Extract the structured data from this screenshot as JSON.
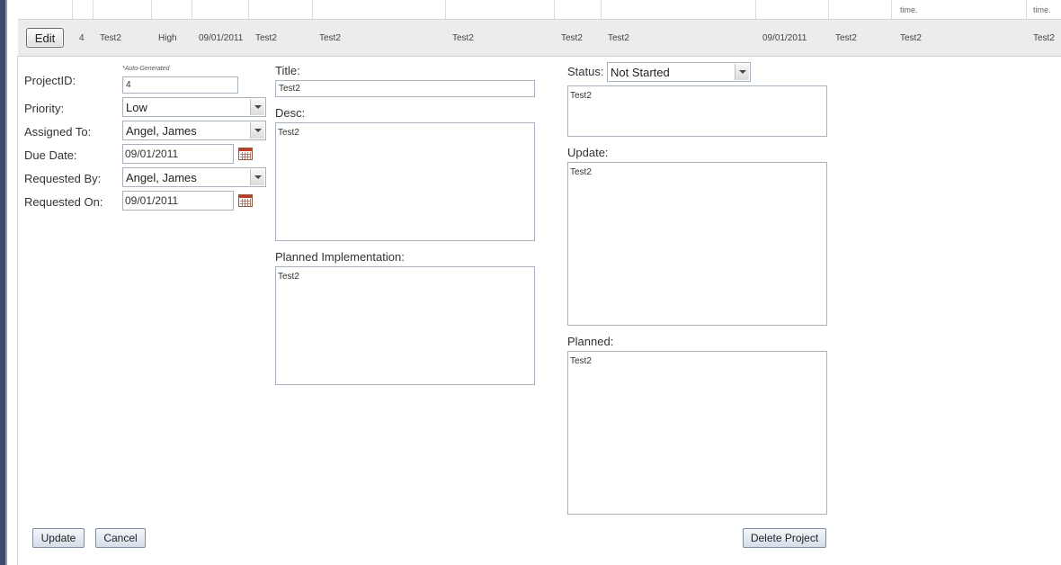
{
  "grid": {
    "header_row": {
      "time_labels": [
        "time.",
        "time."
      ]
    },
    "row": {
      "edit_label": "Edit",
      "id": "4",
      "title": "Test2",
      "priority": "High",
      "due_date": "09/01/2011",
      "col5": "Test2",
      "col6": "Test2",
      "col7": "Test2",
      "col8": "Test2",
      "col9": "Test2",
      "requested_on": "09/01/2011",
      "col11": "Test2",
      "col12": "Test2",
      "col13": "Test2"
    }
  },
  "form": {
    "project_id": {
      "label": "ProjectID:",
      "note": "*Auto-Generated",
      "value": "4"
    },
    "priority": {
      "label": "Priority:",
      "value": "Low"
    },
    "assigned_to": {
      "label": "Assigned To:",
      "value": "Angel, James"
    },
    "due_date": {
      "label": "Due Date:",
      "value": "09/01/2011"
    },
    "requested_by": {
      "label": "Requested By:",
      "value": "Angel, James"
    },
    "requested_on": {
      "label": "Requested On:",
      "value": "09/01/2011"
    },
    "title": {
      "label": "Title:",
      "value": "Test2"
    },
    "desc": {
      "label": "Desc:",
      "value": "Test2"
    },
    "planned_implementation": {
      "label": "Planned Implementation:",
      "value": "Test2"
    },
    "status": {
      "label": "Status:",
      "value": "Not Started",
      "text_value": "Test2"
    },
    "update": {
      "label": "Update:",
      "value": "Test2"
    },
    "planned": {
      "label": "Planned:",
      "value": "Test2"
    }
  },
  "buttons": {
    "update": "Update",
    "cancel": "Cancel",
    "delete": "Delete Project"
  },
  "icons": {
    "calendar": "calendar-icon",
    "dropdown": "chevron-down-icon"
  }
}
